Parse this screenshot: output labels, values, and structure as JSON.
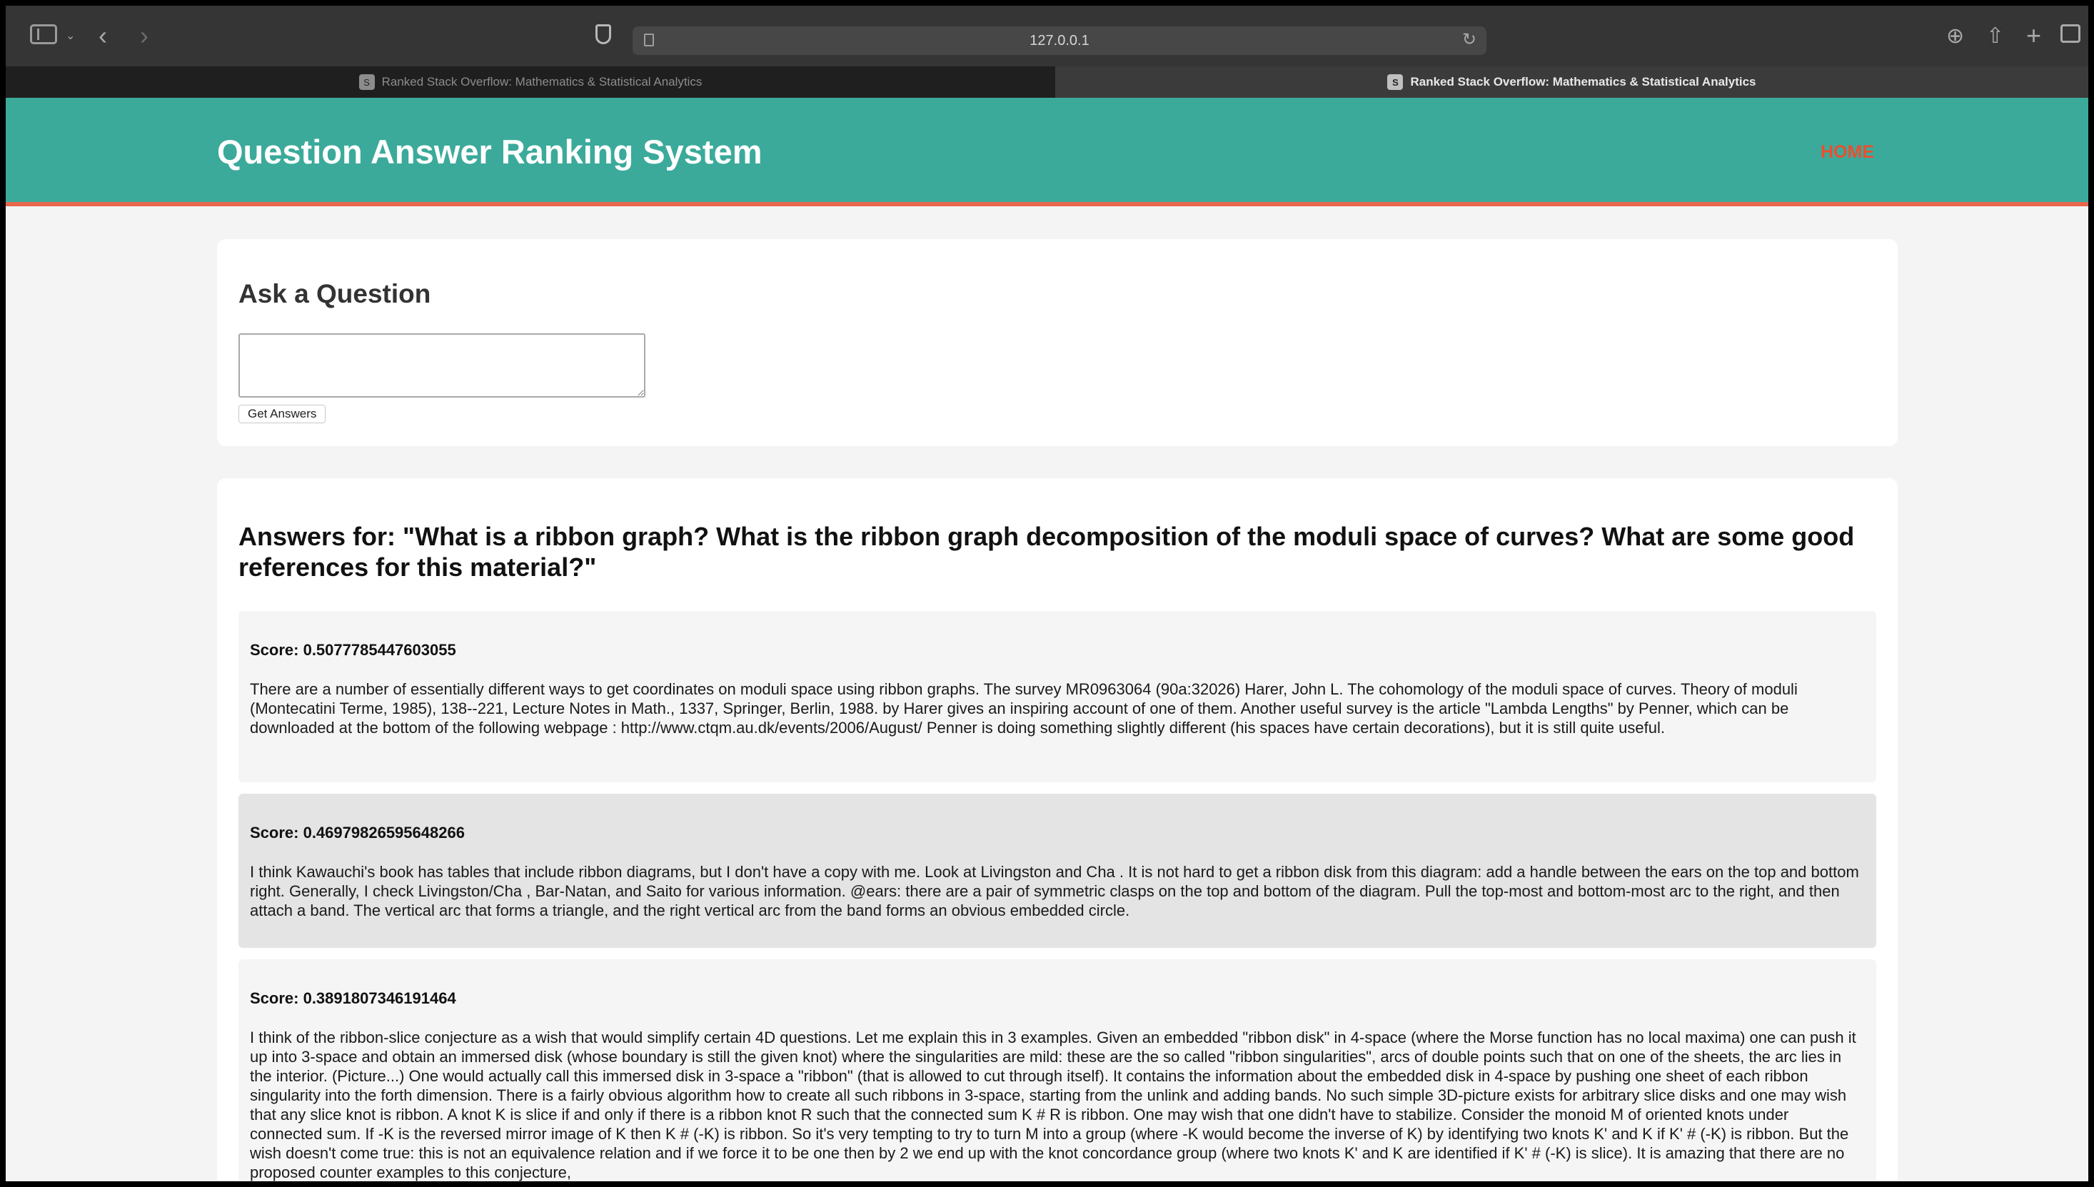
{
  "browser": {
    "url": "127.0.0.1",
    "tabs": [
      {
        "label": "Ranked Stack Overflow: Mathematics & Statistical Analytics",
        "active": false
      },
      {
        "label": "Ranked Stack Overflow: Mathematics & Statistical Analytics",
        "active": true
      }
    ]
  },
  "header": {
    "title": "Question Answer Ranking System",
    "home_label": "HOME"
  },
  "ask": {
    "title": "Ask a Question",
    "input_value": "",
    "button_label": "Get Answers"
  },
  "answers": {
    "title": "Answers for: \"What is a ribbon graph? What is the ribbon graph decomposition of the moduli space of curves? What are some good references for this material?\"",
    "items": [
      {
        "score": "Score: 0.5077785447603055",
        "text": "There are a number of essentially different ways to get coordinates on moduli space using ribbon graphs. The survey MR0963064 (90a:32026) Harer, John L. The cohomology of the moduli space of curves. Theory of moduli (Montecatini Terme, 1985), 138--221, Lecture Notes in Math., 1337, Springer, Berlin, 1988. by Harer gives an inspiring account of one of them. Another useful survey is the article \"Lambda Lengths\" by Penner, which can be downloaded at the bottom of the following webpage : http://www.ctqm.au.dk/events/2006/August/ Penner is doing something slightly different (his spaces have certain decorations), but it is still quite useful."
      },
      {
        "score": "Score: 0.46979826595648266",
        "text": "I think Kawauchi's book has tables that include ribbon diagrams, but I don't have a copy with me. Look at Livingston and Cha . It is not hard to get a ribbon disk from this diagram: add a handle between the ears on the top and bottom right. Generally, I check Livingston/Cha , Bar-Natan, and Saito for various information. @ears: there are a pair of symmetric clasps on the top and bottom of the diagram. Pull the top-most and bottom-most arc to the right, and then attach a band. The vertical arc that forms a triangle, and the right vertical arc from the band forms an obvious embedded circle."
      },
      {
        "score": "Score: 0.3891807346191464",
        "text": "I think of the ribbon-slice conjecture as a wish that would simplify certain 4D questions. Let me explain this in 3 examples. Given an embedded \"ribbon disk\" in 4-space (where the Morse function has no local maxima) one can push it up into 3-space and obtain an immersed disk (whose boundary is still the given knot) where the singularities are mild: these are the so called \"ribbon singularities\", arcs of double points such that on one of the sheets, the arc lies in the interior. (Picture...) One would actually call this immersed disk in 3-space a \"ribbon\" (that is allowed to cut through itself). It contains the information about the embedded disk in 4-space by pushing one sheet of each ribbon singularity into the forth dimension. There is a fairly obvious algorithm how to create all such ribbons in 3-space, starting from the unlink and adding bands. No such simple 3D-picture exists for arbitrary slice disks and one may wish that any slice knot is ribbon. A knot K is slice if and only if there is a ribbon knot R such that the connected sum K # R is ribbon. One may wish that one didn't have to stabilize. Consider the monoid M of oriented knots under connected sum. If -K is the reversed mirror image of K then K # (-K) is ribbon. So it's very tempting to try to turn M into a group (where -K would become the inverse of K) by identifying two knots K' and K if K' # (-K) is ribbon. But the wish doesn't come true: this is not an equivalence relation and if we force it to be one then by 2 we end up with the knot concordance group (where two knots K' and K are identified if K' # (-K) is slice). It is amazing that there are no proposed counter examples to this conjecture,"
      }
    ]
  }
}
